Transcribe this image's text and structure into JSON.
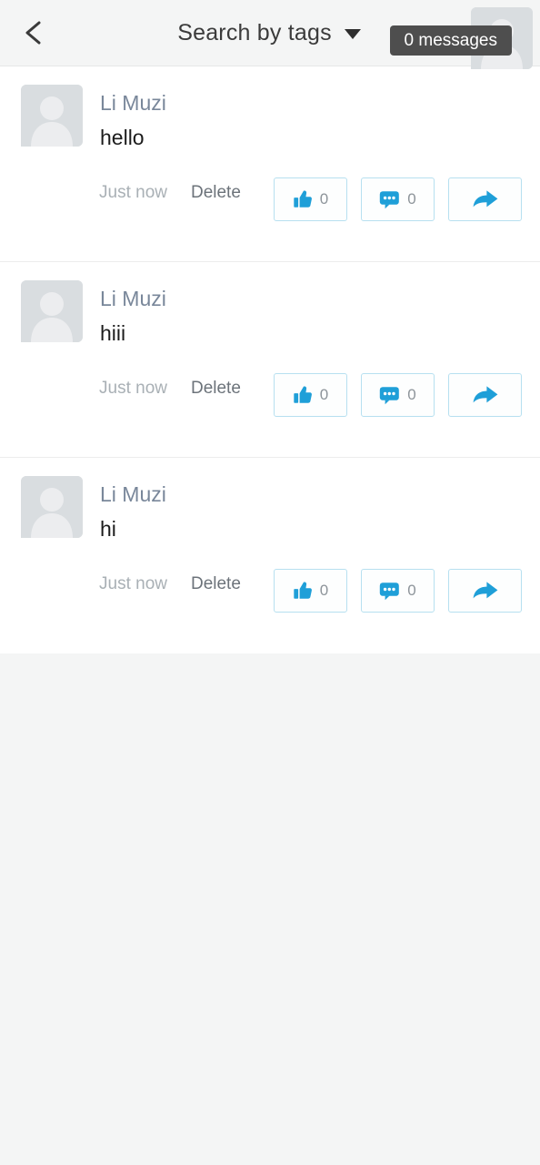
{
  "header": {
    "back_icon": "chevron-left-icon",
    "title": "Search by tags",
    "dropdown_icon": "caret-down-icon",
    "camera_icon": "camera-icon"
  },
  "toast": {
    "text": "0 messages"
  },
  "posts": [
    {
      "author": "Li Muzi",
      "text": "hello",
      "time": "Just now",
      "delete_label": "Delete",
      "like_count": "0",
      "comment_count": "0",
      "like_icon": "thumbs-up-icon",
      "comment_icon": "comment-bubble-icon",
      "share_icon": "share-arrow-icon"
    },
    {
      "author": "Li Muzi",
      "text": "hiii",
      "time": "Just now",
      "delete_label": "Delete",
      "like_count": "0",
      "comment_count": "0",
      "like_icon": "thumbs-up-icon",
      "comment_icon": "comment-bubble-icon",
      "share_icon": "share-arrow-icon"
    },
    {
      "author": "Li Muzi",
      "text": "hi",
      "time": "Just now",
      "delete_label": "Delete",
      "like_count": "0",
      "comment_count": "0",
      "like_icon": "thumbs-up-icon",
      "comment_icon": "comment-bubble-icon",
      "share_icon": "share-arrow-icon"
    }
  ],
  "colors": {
    "accent": "#1f9fd8",
    "header_bg": "#f4f5f5",
    "page_bg": "#f4f5f5",
    "card_bg": "#ffffff",
    "author": "#79879a",
    "toast_bg": "#4e4e4e",
    "button_border": "#b7e0f0",
    "avatar_bg": "#d9dde0"
  }
}
